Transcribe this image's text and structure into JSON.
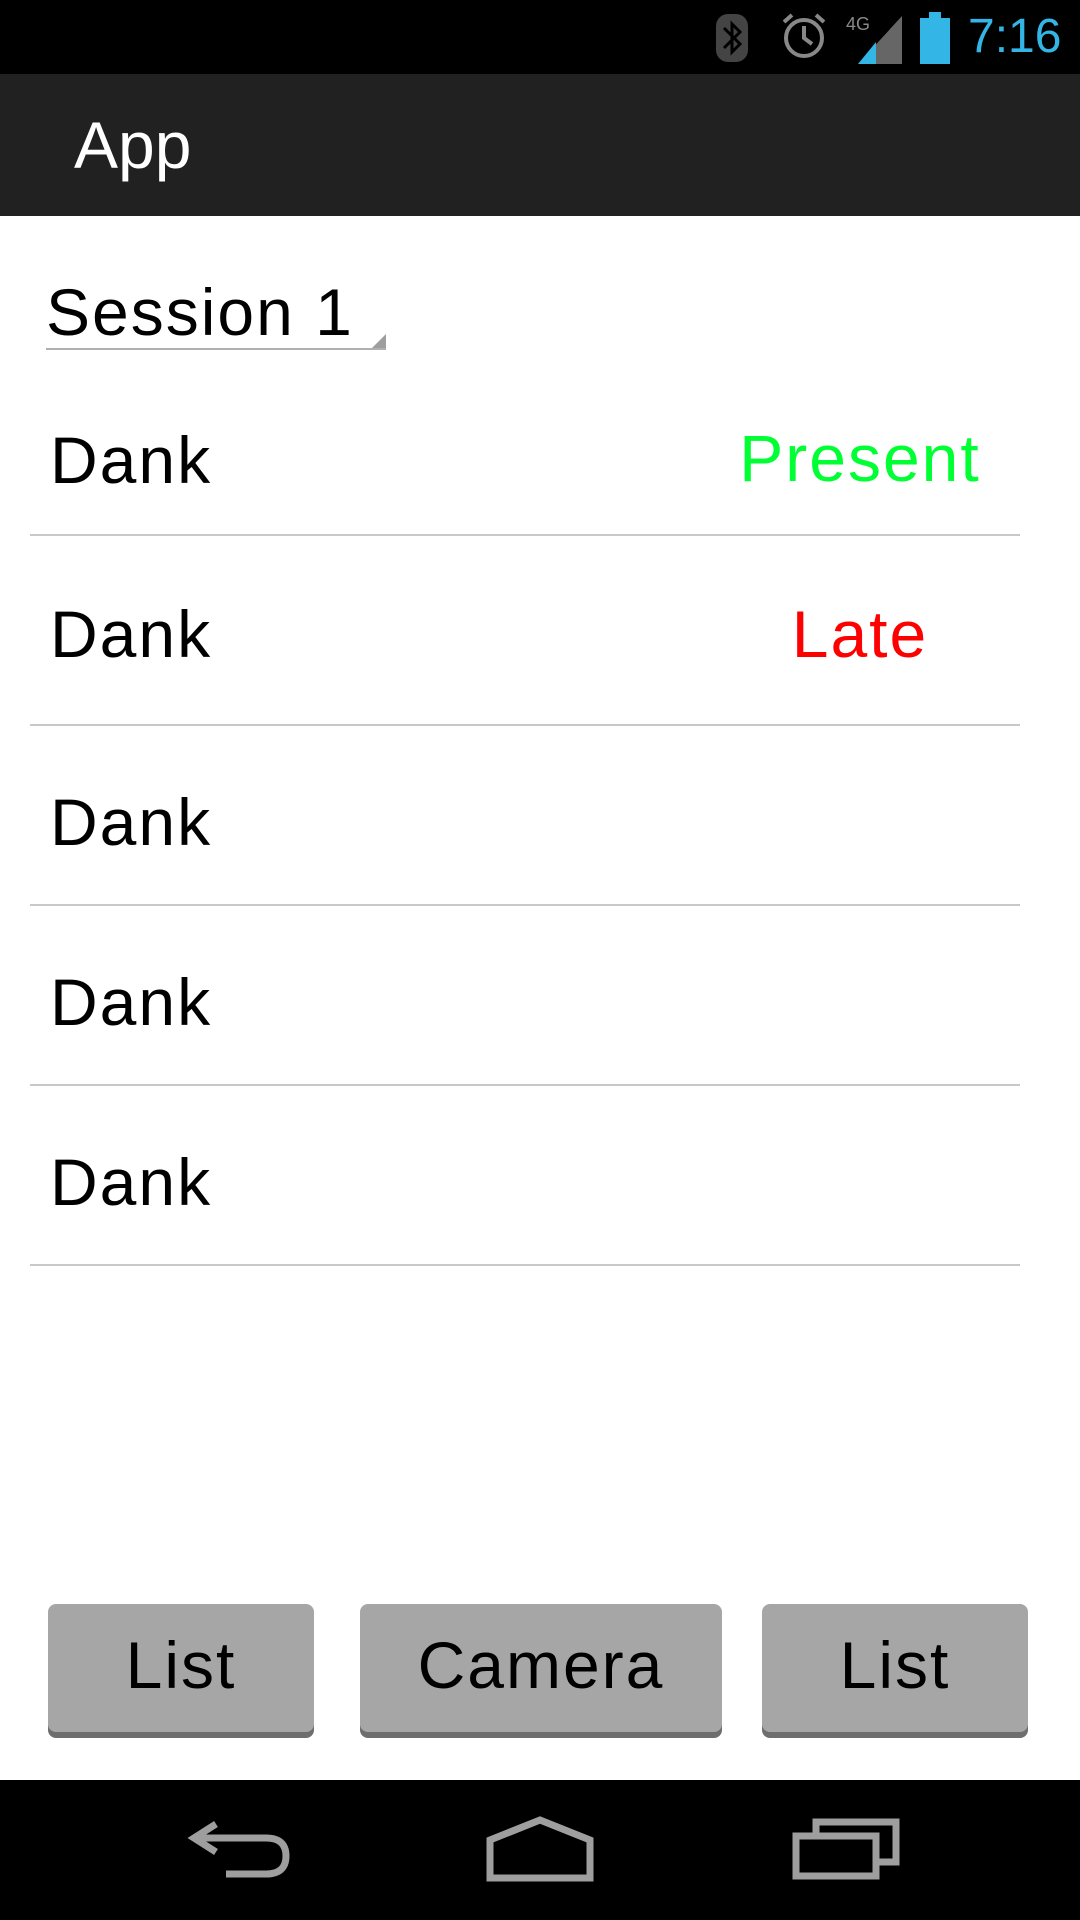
{
  "status_bar": {
    "time": "7:16",
    "network_label": "4G",
    "icons": [
      "bluetooth-icon",
      "alarm-icon",
      "signal-icon",
      "battery-icon"
    ],
    "time_color": "#33b5e5"
  },
  "action_bar": {
    "title": "App"
  },
  "session_spinner": {
    "selected": "Session 1"
  },
  "list": {
    "rows": [
      {
        "name": "Dank",
        "status": "Present",
        "status_color": "#00ff33"
      },
      {
        "name": "Dank",
        "status": "Late",
        "status_color": "#ff0000"
      },
      {
        "name": "Dank",
        "status": ""
      },
      {
        "name": "Dank",
        "status": ""
      },
      {
        "name": "Dank",
        "status": ""
      }
    ]
  },
  "buttons": {
    "list_left": "List",
    "camera": "Camera",
    "list_right": "List"
  },
  "nav_bar": {
    "icons": [
      "back-icon",
      "home-icon",
      "recents-icon"
    ]
  }
}
